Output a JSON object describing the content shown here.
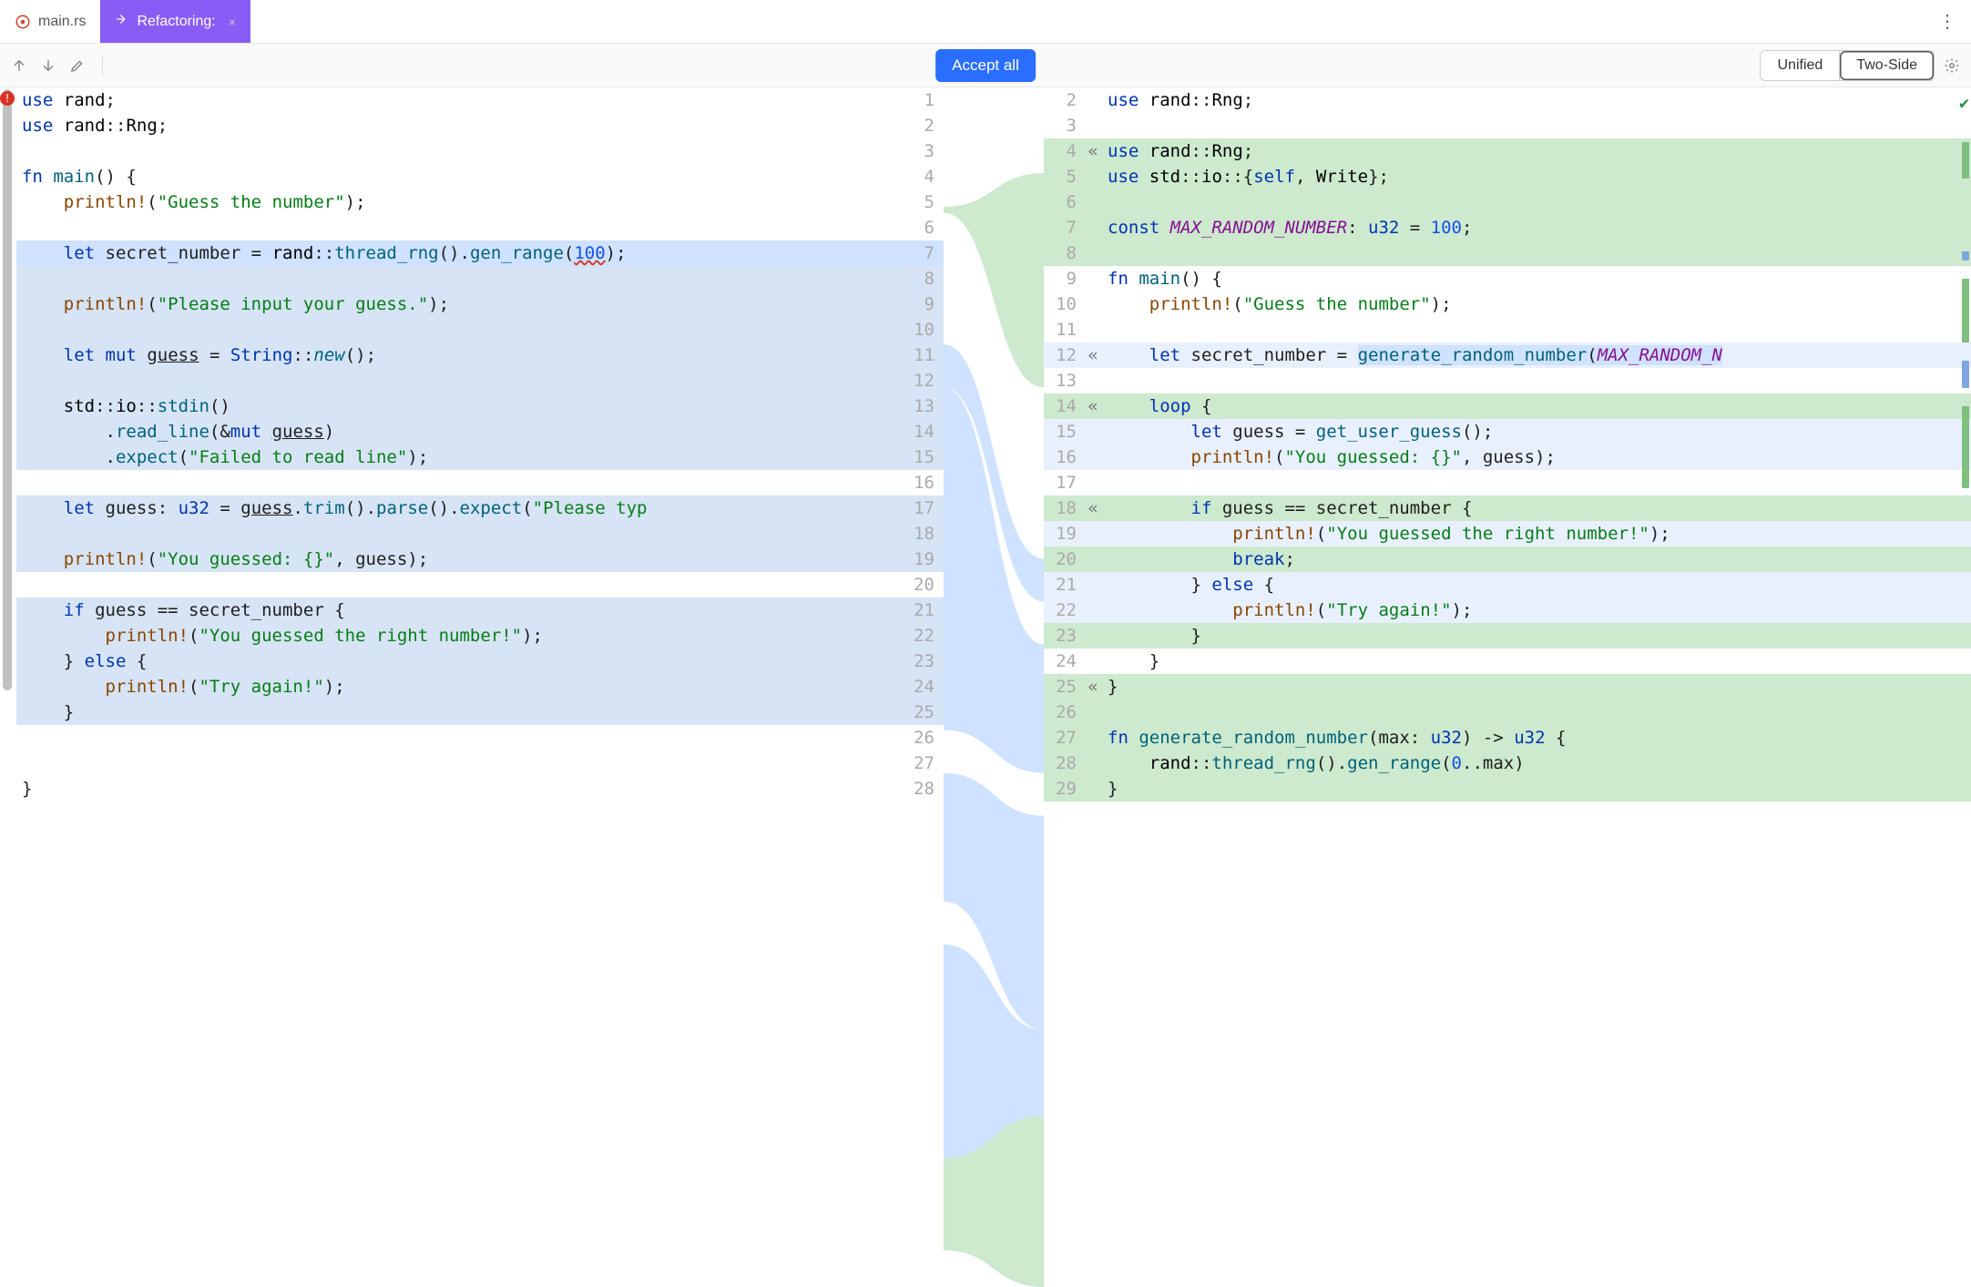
{
  "tabs": [
    {
      "label": "main.rs",
      "icon": "rust",
      "active": false
    },
    {
      "label": "Refactoring:",
      "icon": "refactor",
      "active": true
    }
  ],
  "toolbar": {
    "accept_label": "Accept all",
    "unified_label": "Unified",
    "twoside_label": "Two-Side"
  },
  "left_lines": [
    {
      "n": 1,
      "bg": "none",
      "html": "<span class='kw'>use</span> <span class='ns'>rand</span>;"
    },
    {
      "n": 2,
      "bg": "none",
      "html": "<span class='kw'>use</span> <span class='ns'>rand</span>::<span class='ns'>Rng</span>;"
    },
    {
      "n": 3,
      "bg": "none",
      "html": ""
    },
    {
      "n": 4,
      "bg": "none",
      "html": "<span class='kw'>fn</span> <span class='fn'>main</span>() {"
    },
    {
      "n": 5,
      "bg": "none",
      "html": "    <span class='macro'>println!</span>(<span class='str'>\"Guess the number\"</span>);"
    },
    {
      "n": 6,
      "bg": "none",
      "html": ""
    },
    {
      "n": 7,
      "bg": "mod",
      "html": "    <span class='kw'>let</span> secret_number = <span class='ns'>rand</span>::<span class='fn'>thread_rng</span>().<span class='fn'>gen_range</span>(<span class='num ul wavy'>100</span>);"
    },
    {
      "n": 8,
      "bg": "del",
      "html": ""
    },
    {
      "n": 9,
      "bg": "del",
      "html": "    <span class='macro'>println!</span>(<span class='str'>\"Please input your guess.\"</span>);"
    },
    {
      "n": 10,
      "bg": "del",
      "html": ""
    },
    {
      "n": 11,
      "bg": "del",
      "html": "    <span class='kw'>let</span> <span class='kw'>mut</span> <span class='mut'>guess</span> = <span class='ty'>String</span>::<span class='fn' style='font-style:italic'>new</span>();"
    },
    {
      "n": 12,
      "bg": "del",
      "html": ""
    },
    {
      "n": 13,
      "bg": "del",
      "html": "    <span class='ns'>std</span>::<span class='ns'>io</span>::<span class='fn'>stdin</span>()"
    },
    {
      "n": 14,
      "bg": "del",
      "html": "        .<span class='fn'>read_line</span>(&<span class='kw'>mut</span> <span class='mut'>guess</span>)"
    },
    {
      "n": 15,
      "bg": "del",
      "html": "        .<span class='fn'>expect</span>(<span class='str'>\"Failed to read line\"</span>);"
    },
    {
      "n": 16,
      "bg": "none",
      "html": ""
    },
    {
      "n": 17,
      "bg": "del",
      "html": "    <span class='kw'>let</span> guess: <span class='ty'>u32</span> = <span class='mut'>guess</span>.<span class='fn'>trim</span>().<span class='fn'>parse</span>().<span class='fn'>expect</span>(<span class='str'>\"Please typ</span>"
    },
    {
      "n": 18,
      "bg": "del",
      "html": ""
    },
    {
      "n": 19,
      "bg": "del",
      "html": "    <span class='macro'>println!</span>(<span class='str'>\"You guessed: {}\"</span>, guess);"
    },
    {
      "n": 20,
      "bg": "none",
      "html": ""
    },
    {
      "n": 21,
      "bg": "del",
      "html": "    <span class='kw'>if</span> guess == secret_number {"
    },
    {
      "n": 22,
      "bg": "del",
      "html": "        <span class='macro'>println!</span>(<span class='str'>\"You guessed the right number!\"</span>);"
    },
    {
      "n": 23,
      "bg": "del",
      "html": "    } <span class='kw'>else</span> {"
    },
    {
      "n": 24,
      "bg": "del",
      "html": "        <span class='macro'>println!</span>(<span class='str'>\"Try again!\"</span>);"
    },
    {
      "n": 25,
      "bg": "del",
      "html": "    }"
    },
    {
      "n": 26,
      "bg": "none",
      "html": ""
    },
    {
      "n": 27,
      "bg": "none",
      "html": ""
    },
    {
      "n": 28,
      "bg": "none",
      "html": "}"
    }
  ],
  "right_lines": [
    {
      "n": 2,
      "bg": "none",
      "fold": "",
      "html": "<span class='kw'>use</span> <span class='ns'>rand</span>::<span class='ns'>Rng</span>;"
    },
    {
      "n": 3,
      "bg": "none",
      "fold": "",
      "html": ""
    },
    {
      "n": 4,
      "bg": "add",
      "fold": "«",
      "html": "<span class='kw'>use</span> <span class='ns'>rand</span>::<span class='ns'>Rng</span>;"
    },
    {
      "n": 5,
      "bg": "add",
      "fold": "",
      "html": "<span class='kw'>use</span> <span class='ns'>std</span>::<span class='ns'>io</span>::{<span class='self'>self</span>, <span class='ns'>Write</span>};"
    },
    {
      "n": 6,
      "bg": "add",
      "fold": "",
      "html": ""
    },
    {
      "n": 7,
      "bg": "add",
      "fold": "",
      "html": "<span class='kw'>const</span> <span class='const'>MAX_RANDOM_NUMBER</span>: <span class='ty'>u32</span> = <span class='num'>100</span>;"
    },
    {
      "n": 8,
      "bg": "add",
      "fold": "",
      "html": ""
    },
    {
      "n": 9,
      "bg": "none",
      "fold": "",
      "html": "<span class='kw'>fn</span> <span class='fn'>main</span>() {"
    },
    {
      "n": 10,
      "bg": "none",
      "fold": "",
      "html": "    <span class='macro'>println!</span>(<span class='str'>\"Guess the number\"</span>);"
    },
    {
      "n": 11,
      "bg": "none",
      "fold": "",
      "html": ""
    },
    {
      "n": 12,
      "bg": "modL",
      "fold": "«",
      "html": "    <span class='kw'>let</span> secret_number = <span style='background:#cfe2ff'><span class='fn'>generate_random_number</span>(<span class='const'>MAX_RANDOM_N</span></span>"
    },
    {
      "n": 13,
      "bg": "none",
      "fold": "",
      "html": ""
    },
    {
      "n": 14,
      "bg": "add",
      "fold": "«",
      "html": "    <span class='kw'>loop</span> {"
    },
    {
      "n": 15,
      "bg": "modL",
      "fold": "",
      "html": "        <span class='kw'>let</span> guess = <span class='fn'>get_user_guess</span>();"
    },
    {
      "n": 16,
      "bg": "modL",
      "fold": "",
      "html": "        <span class='macro'>println!</span>(<span class='str'>\"You guessed: {}\"</span>, guess);"
    },
    {
      "n": 17,
      "bg": "none",
      "fold": "",
      "html": ""
    },
    {
      "n": 18,
      "bg": "add",
      "fold": "«",
      "html": "        <span class='kw'>if</span> guess == secret_number {"
    },
    {
      "n": 19,
      "bg": "modL",
      "fold": "",
      "html": "            <span class='macro'>println!</span>(<span class='str'>\"You guessed the right number!\"</span>);"
    },
    {
      "n": 20,
      "bg": "add",
      "fold": "",
      "html": "            <span class='kw'>break</span>;"
    },
    {
      "n": 21,
      "bg": "modL",
      "fold": "",
      "html": "        } <span class='kw'>else</span> {"
    },
    {
      "n": 22,
      "bg": "modL",
      "fold": "",
      "html": "            <span class='macro'>println!</span>(<span class='str'>\"Try again!\"</span>);"
    },
    {
      "n": 23,
      "bg": "add",
      "fold": "",
      "html": "        }"
    },
    {
      "n": 24,
      "bg": "none",
      "fold": "",
      "html": "    }"
    },
    {
      "n": 25,
      "bg": "add",
      "fold": "«",
      "html": "}"
    },
    {
      "n": 26,
      "bg": "add",
      "fold": "",
      "html": ""
    },
    {
      "n": 27,
      "bg": "add",
      "fold": "",
      "html": "<span class='kw'>fn</span> <span class='fn'>generate_random_number</span>(max: <span class='ty'>u32</span>) -> <span class='ty'>u32</span> {"
    },
    {
      "n": 28,
      "bg": "add",
      "fold": "",
      "html": "    <span class='ns'>rand</span>::<span class='fn'>thread_rng</span>().<span class='fn'>gen_range</span>(<span class='num'>0</span>..max)"
    },
    {
      "n": 29,
      "bg": "add",
      "fold": "",
      "html": "}"
    }
  ]
}
